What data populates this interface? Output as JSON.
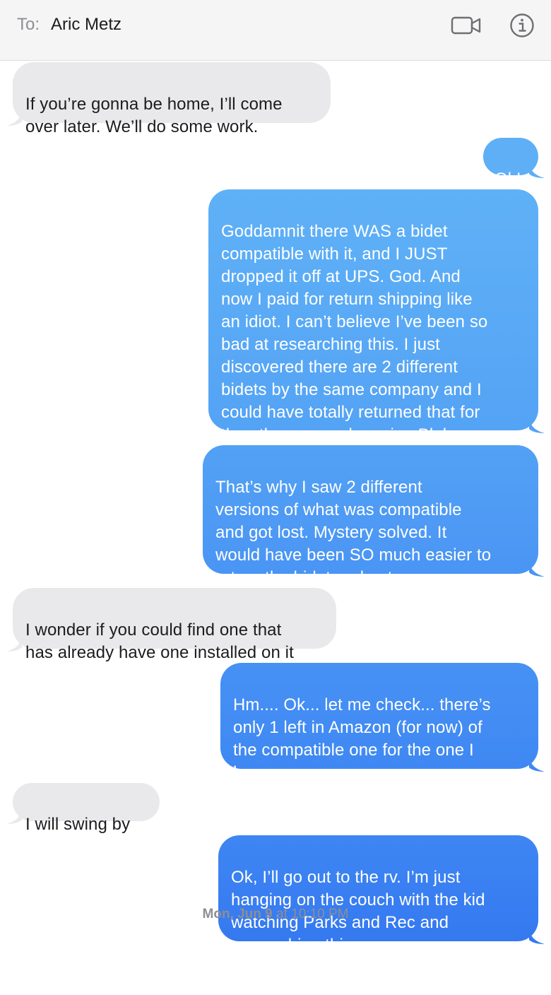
{
  "header": {
    "to_label": "To:",
    "recipient": "Aric Metz",
    "video_icon": "video-camera-icon",
    "info_icon": "info-circle-icon"
  },
  "colors": {
    "incoming_bubble": "#e9e9eb",
    "outgoing_gradient_top": "#5fb1f6",
    "outgoing_gradient_bottom": "#3579f0",
    "header_bg": "#f5f5f5"
  },
  "messages": [
    {
      "direction": "incoming",
      "text": "If you’re gonna be home, I’ll come\nover later. We’ll do some work."
    },
    {
      "direction": "outgoing",
      "text": "Ok!"
    },
    {
      "direction": "outgoing",
      "text": "Goddamnit there WAS a bidet\ncompatible with it, and I JUST\ndropped it off at UPS. God. And\nnow I paid for return shipping like\nan idiot. I can’t believe I’ve been so\nbad at researching this. I just\ndiscovered there are 2 different\nbidets by the same company and I\ncould have totally returned that for\nthe other so much easier. Bleh."
    },
    {
      "direction": "outgoing",
      "text": "That’s why I saw 2 different\nversions of what was compatible\nand got lost. Mystery solved. It\nwould have been SO much easier to\nreturn the bidet and get a new one."
    },
    {
      "direction": "incoming",
      "text": "I wonder if you could find one that\nhas already have one installed on it"
    },
    {
      "direction": "outgoing",
      "text": "Hm.... Ok... let me check... there’s\nonly 1 left in Amazon (for now) of\nthe compatible one for the one I\nhave now."
    },
    {
      "direction": "incoming",
      "text": "I will swing by"
    },
    {
      "direction": "outgoing",
      "text": "Ok, I’ll go out to the rv. I’m just\nhanging on the couch with the kid\nwatching Parks and Rec and\nresearching things."
    }
  ],
  "timestamp": {
    "day": "Mon, Jun 9",
    "time": " at 10:10 PM"
  }
}
